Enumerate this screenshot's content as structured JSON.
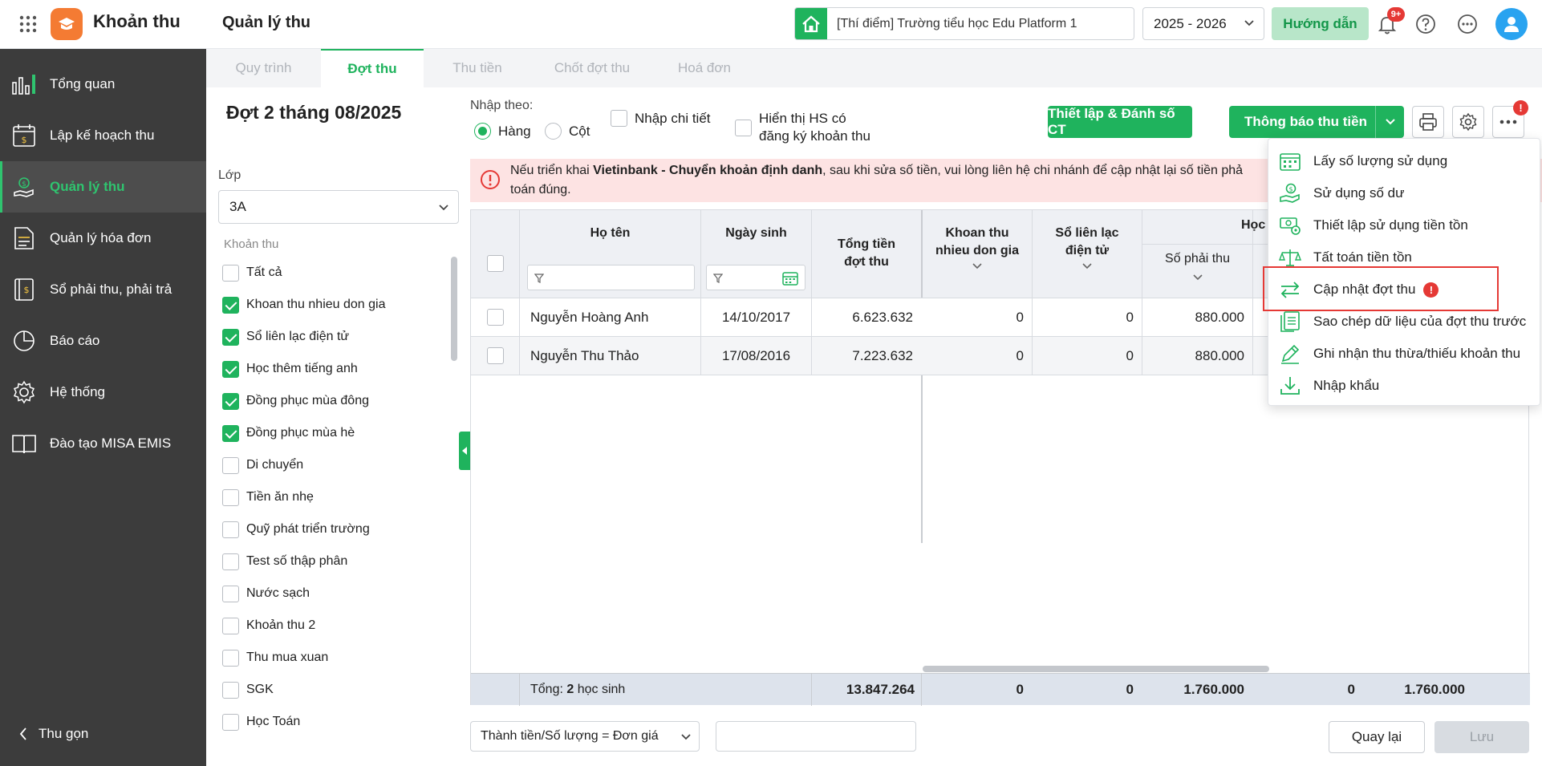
{
  "app": {
    "name": "Khoản thu",
    "page_title": "Quản lý thu"
  },
  "header": {
    "school": "[Thí điểm] Trường tiểu học Edu Platform 1",
    "year": "2025 - 2026",
    "guide_label": "Hướng dẫn",
    "notif_count": "9+"
  },
  "sidebar": {
    "items": [
      {
        "label": "Tổng quan"
      },
      {
        "label": "Lập kế hoạch thu"
      },
      {
        "label": "Quản lý thu"
      },
      {
        "label": "Quản lý hóa đơn"
      },
      {
        "label": "Sổ phải thu, phải trả"
      },
      {
        "label": "Báo cáo"
      },
      {
        "label": "Hệ thống"
      },
      {
        "label": "Đào tạo MISA EMIS"
      }
    ],
    "collapse_label": "Thu gọn"
  },
  "tabs": [
    "Quy trình",
    "Đợt thu",
    "Thu tiền",
    "Chốt đợt thu",
    "Hoá đơn"
  ],
  "batch": {
    "title": "Đợt 2 tháng 08/2025"
  },
  "filter": {
    "class_label": "Lớp",
    "class_value": "3A",
    "fees_label": "Khoản thu",
    "fees": [
      {
        "label": "Tất cả",
        "checked": false
      },
      {
        "label": "Khoan thu nhieu don gia",
        "checked": true
      },
      {
        "label": "Sổ liên lạc điện tử",
        "checked": true
      },
      {
        "label": "Học thêm tiếng anh",
        "checked": true
      },
      {
        "label": "Đồng phục mùa đông",
        "checked": true
      },
      {
        "label": "Đồng phục mùa hè",
        "checked": true
      },
      {
        "label": "Di chuyển",
        "checked": false
      },
      {
        "label": "Tiền ăn nhẹ",
        "checked": false
      },
      {
        "label": "Quỹ phát triển trường",
        "checked": false
      },
      {
        "label": "Test số thập phân",
        "checked": false
      },
      {
        "label": "Nước sạch",
        "checked": false
      },
      {
        "label": "Khoản thu 2",
        "checked": false
      },
      {
        "label": "Thu mua xuan",
        "checked": false
      },
      {
        "label": "SGK",
        "checked": false
      },
      {
        "label": "Học Toán",
        "checked": false
      }
    ]
  },
  "input_mode": {
    "label": "Nhập theo:",
    "row": "Hàng",
    "col": "Cột",
    "detail": "Nhập chi tiết",
    "show_hs_1": "Hiển thị HS có",
    "show_hs_2": "đăng ký khoản thu"
  },
  "actions": {
    "setup": "Thiết lập & Đánh số CT",
    "notify": "Thông báo thu tiền"
  },
  "alert": {
    "prefix": "Nếu triển khai ",
    "bank": "Vietinbank - Chuyển khoản định danh",
    "suffix": ", sau khi sửa số tiền, vui lòng liên hệ chi nhánh để cập nhật lại số tiền phả",
    "line2": "toán đúng."
  },
  "table": {
    "headers": {
      "name": "Họ tên",
      "dob": "Ngày sinh",
      "total_1": "Tổng tiền",
      "total_2": "đợt thu",
      "multi_1": "Khoan thu",
      "multi_2": "nhieu don gia",
      "sll_1": "Sổ liên lạc",
      "sll_2": "điện tử",
      "group": "Học",
      "payable": "Số phải thu"
    },
    "rows": [
      {
        "name": "Nguyễn Hoàng Anh",
        "dob": "14/10/2017",
        "total": "6.623.632",
        "multi": "0",
        "sll": "0",
        "payable": "880.000"
      },
      {
        "name": "Nguyễn Thu Thảo",
        "dob": "17/08/2016",
        "total": "7.223.632",
        "multi": "0",
        "sll": "0",
        "payable": "880.000"
      }
    ],
    "footer": {
      "label_prefix": "Tổng: ",
      "count": "2",
      "label_suffix": " học sinh",
      "total": "13.847.264",
      "multi": "0",
      "sll": "0",
      "payable": "1.760.000",
      "c5": "0",
      "c6": "1.760.000"
    }
  },
  "bottom": {
    "formula": "Thành tiền/Số lượng = Đơn giá",
    "back": "Quay lại",
    "save": "Lưu"
  },
  "menu": {
    "items": [
      {
        "label": "Lấy số lượng sử dụng"
      },
      {
        "label": "Sử dụng số dư"
      },
      {
        "label": "Thiết lập sử dụng tiền tồn"
      },
      {
        "label": "Tất toán tiền tồn"
      },
      {
        "label": "Cập nhật đợt thu"
      },
      {
        "label": "Sao chép dữ liệu của đợt thu trước"
      },
      {
        "label": "Ghi nhận thu thừa/thiếu khoản thu"
      },
      {
        "label": "Nhập khẩu"
      }
    ]
  },
  "colors": {
    "accent": "#1fb35d",
    "sidebar": "#3c3c3c",
    "alert_bg": "#fde3e3",
    "alert_red": "#e53935",
    "logo": "#f47b33"
  }
}
